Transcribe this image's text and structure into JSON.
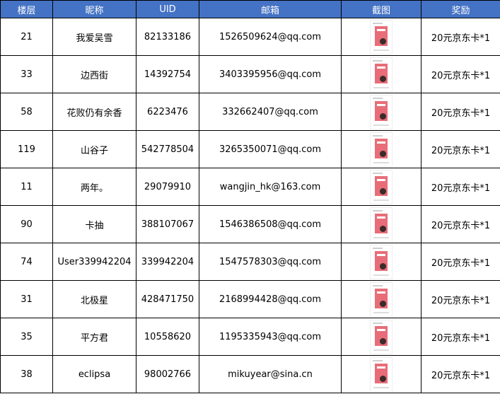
{
  "headers": [
    "楼层",
    "昵称",
    "UID",
    "邮箱",
    "截图",
    "奖励"
  ],
  "screenshot_icon": "screenshot-thumbnail",
  "colors": {
    "header_bg": "#4472c4",
    "header_text": "#ffffff",
    "border": "#000000"
  },
  "rows": [
    {
      "floor": "21",
      "nickname": "我爱吴雪",
      "uid": "82133186",
      "email": "1526509624@qq.com",
      "reward": "20元京东卡*1"
    },
    {
      "floor": "33",
      "nickname": "边西街",
      "uid": "14392754",
      "email": "3403395956@qq.com",
      "reward": "20元京东卡*1"
    },
    {
      "floor": "58",
      "nickname": "花败仍有余香",
      "uid": "6223476",
      "email": "332662407@qq.com",
      "reward": "20元京东卡*1"
    },
    {
      "floor": "119",
      "nickname": "山谷子",
      "uid": "542778504",
      "email": "3265350071@qq.com",
      "reward": "20元京东卡*1"
    },
    {
      "floor": "11",
      "nickname": "两年。",
      "uid": "29079910",
      "email": "wangjin_hk@163.com",
      "reward": "20元京东卡*1"
    },
    {
      "floor": "90",
      "nickname": "卡抽",
      "uid": "388107067",
      "email": "1546386508@qq.com",
      "reward": "20元京东卡*1"
    },
    {
      "floor": "74",
      "nickname": "User339942204",
      "uid": "339942204",
      "email": "1547578303@qq.com",
      "reward": "20元京东卡*1"
    },
    {
      "floor": "31",
      "nickname": "北极星",
      "uid": "428471750",
      "email": "2168994428@qq.com",
      "reward": "20元京东卡*1"
    },
    {
      "floor": "35",
      "nickname": "平方君",
      "uid": "10558620",
      "email": "1195335943@qq.com",
      "reward": "20元京东卡*1"
    },
    {
      "floor": "38",
      "nickname": "eclipsa",
      "uid": "98002766",
      "email": "mikuyear@sina.cn",
      "reward": "20元京东卡*1"
    }
  ]
}
